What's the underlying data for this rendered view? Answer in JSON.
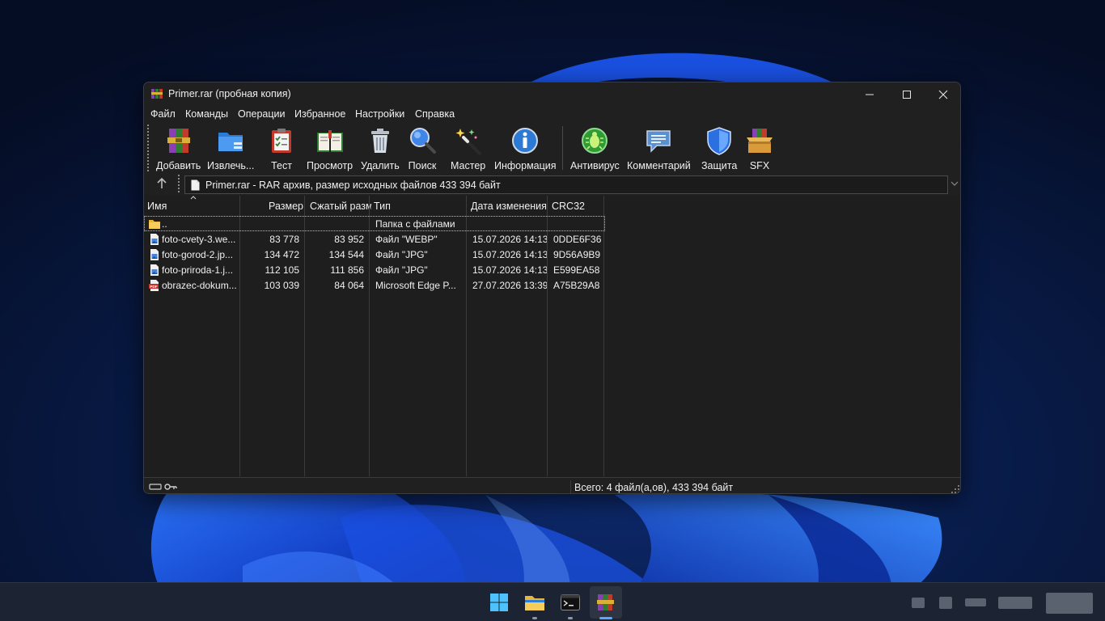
{
  "window": {
    "title": "Primer.rar (пробная копия)",
    "controls": {
      "minimize": "minimize",
      "maximize": "maximize",
      "close": "close"
    }
  },
  "menu": [
    "Файл",
    "Команды",
    "Операции",
    "Избранное",
    "Настройки",
    "Справка"
  ],
  "toolbar": {
    "add": "Добавить",
    "extract": "Извлечь...",
    "test": "Тест",
    "view": "Просмотр",
    "delete": "Удалить",
    "find": "Поиск",
    "wizard": "Мастер",
    "info": "Информация",
    "virus": "Антивирус",
    "comment": "Комментарий",
    "protect": "Защита",
    "sfx": "SFX"
  },
  "address": {
    "text": "Primer.rar - RAR архив, размер исходных файлов 433 394 байт"
  },
  "columns": {
    "name": "Имя",
    "size": "Размер",
    "packed": "Сжатый разм",
    "type": "Тип",
    "modified": "Дата изменения",
    "crc": "CRC32"
  },
  "files": [
    {
      "icon": "folder-icon",
      "name": "..",
      "size": "",
      "packed": "",
      "type": "Папка с файлами",
      "modified": "",
      "crc": ""
    },
    {
      "icon": "image-file-icon",
      "name": "foto-cvety-3.we...",
      "size": "83 778",
      "packed": "83 952",
      "type": "Файл \"WEBP\"",
      "modified": "15.07.2026 14:13",
      "crc": "0DDE6F36"
    },
    {
      "icon": "image-file-icon",
      "name": "foto-gorod-2.jp...",
      "size": "134 472",
      "packed": "134 544",
      "type": "Файл \"JPG\"",
      "modified": "15.07.2026 14:13",
      "crc": "9D56A9B9"
    },
    {
      "icon": "image-file-icon",
      "name": "foto-priroda-1.j...",
      "size": "112 105",
      "packed": "111 856",
      "type": "Файл \"JPG\"",
      "modified": "15.07.2026 14:13",
      "crc": "E599EA58"
    },
    {
      "icon": "pdf-file-icon",
      "name": "obrazec-dokum...",
      "size": "103 039",
      "packed": "84 064",
      "type": "Microsoft Edge P...",
      "modified": "27.07.2026 13:39",
      "crc": "A75B29A8"
    }
  ],
  "status": {
    "text": "Всего: 4 файл(а,ов), 433 394 байт"
  },
  "colors": {
    "window_bg": "#1e1e1e",
    "chrome_bg": "#202020",
    "taskbar_bg": "#1c2434",
    "accent": "#58a8ff"
  },
  "taskbar": {
    "apps": [
      "windows-start-icon",
      "file-explorer-icon",
      "terminal-icon",
      "winrar-icon"
    ],
    "active": "winrar-icon"
  }
}
